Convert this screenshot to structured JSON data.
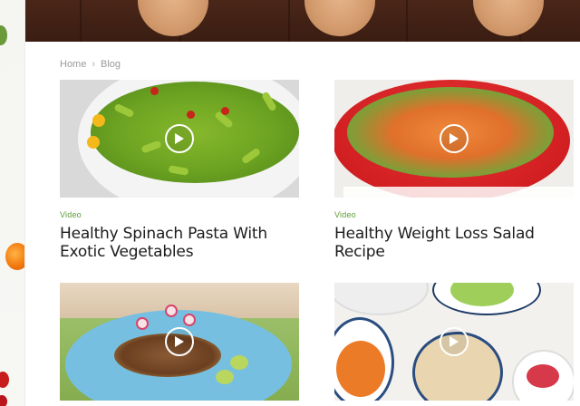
{
  "breadcrumb": {
    "home": "Home",
    "separator": "›",
    "current": "Blog"
  },
  "posts": [
    {
      "category": "Video",
      "title": "Healthy Spinach Pasta With Exotic Vegetables",
      "thumb_icon": "play-icon"
    },
    {
      "category": "Video",
      "title": "Healthy Weight Loss Salad Recipe",
      "thumb_icon": "play-icon"
    },
    {
      "category": "",
      "title": "",
      "thumb_icon": "play-icon"
    },
    {
      "category": "",
      "title": "",
      "thumb_icon": "play-icon"
    }
  ],
  "colors": {
    "category": "#5a9d35",
    "title": "#1c1c1c",
    "breadcrumb": "#9a9a9a",
    "wood": "#3a1d12"
  }
}
